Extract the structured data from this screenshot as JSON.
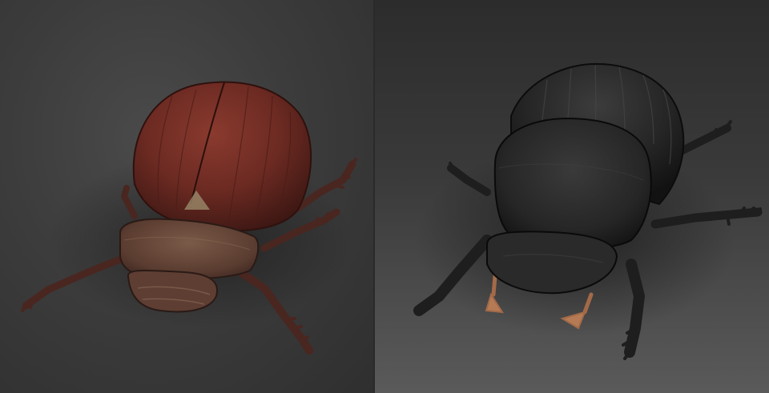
{
  "scene": {
    "panels": [
      {
        "subject": "beetle-icon",
        "color": "#6b2a22"
      },
      {
        "subject": "beetle-icon",
        "color": "#252525"
      }
    ],
    "background_left": "#3d3d3d",
    "background_right": "#4a4a4a"
  }
}
